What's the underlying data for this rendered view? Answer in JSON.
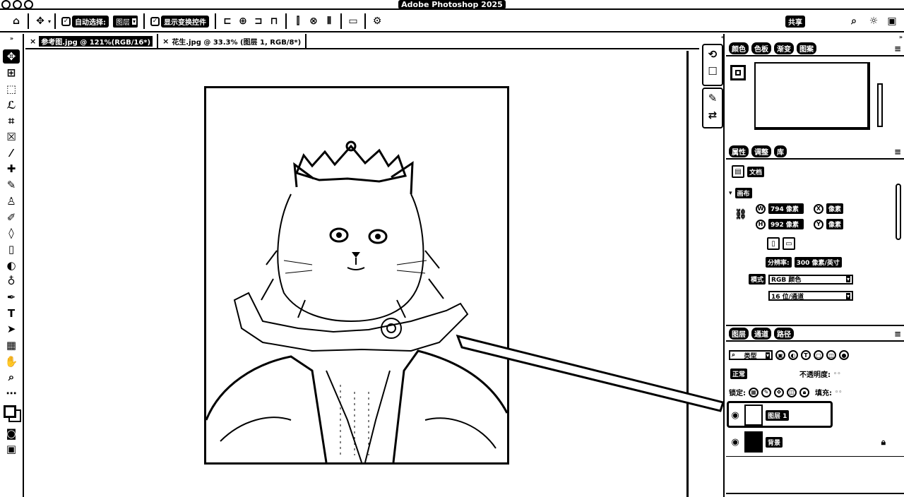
{
  "window": {
    "title": "Adobe Photoshop 2025"
  },
  "options_bar": {
    "home_icon": "home-icon",
    "move_icon": "move-tool-icon",
    "auto_select_label": "自动选择:",
    "auto_select_target": "图层",
    "show_transform_label": "显示变换控件",
    "share_label": "共享",
    "align_icons": [
      "align-left-icon",
      "align-hcenter-icon",
      "align-right-icon",
      "align-top-icon",
      "align-vcenter-icon",
      "align-bottom-icon",
      "distribute-icon"
    ],
    "right_icons": [
      "search-icon",
      "lightbulb-icon",
      "workspace-icon"
    ]
  },
  "tabs": [
    {
      "label": "参考图.jpg @ 121%(RGB/16*)",
      "active": true
    },
    {
      "label": "花生.jpg @ 33.3% (图层 1, RGB/8*)",
      "active": false
    }
  ],
  "tools": [
    "move-tool",
    "artboard-tool",
    "marquee-tool",
    "lasso-tool",
    "crop-tool",
    "frame-tool",
    "eyedropper-tool",
    "healing-brush-tool",
    "brush-tool",
    "clone-stamp-tool",
    "history-brush-tool",
    "eraser-tool",
    "gradient-tool",
    "blur-tool",
    "dodge-tool",
    "pen-tool",
    "type-tool",
    "path-selection-tool",
    "rectangle-tool",
    "hand-tool",
    "zoom-tool",
    "more-tools"
  ],
  "color_panel": {
    "tabs": [
      "颜色",
      "色板",
      "渐变",
      "图案"
    ]
  },
  "properties_panel": {
    "tabs": [
      "属性",
      "调整",
      "库"
    ],
    "document_label": "文档",
    "canvas_section": "画布",
    "width_label": "W",
    "width_value": "794 像素",
    "height_label": "H",
    "height_value": "992 像素",
    "x_label": "X",
    "x_value": "像素",
    "y_label": "Y",
    "y_value": "像素",
    "resolution_label": "分辨率:",
    "resolution_value": "300 像素/英寸",
    "mode_label": "模式",
    "mode_value": "RGB 颜色",
    "depth_value": "16 位/通道"
  },
  "layers_panel": {
    "tabs": [
      "图层",
      "通道",
      "路径"
    ],
    "filter_label": "类型",
    "blend_mode": "正常",
    "opacity_label": "不透明度:",
    "lock_label": "锁定:",
    "fill_label": "填充:",
    "layers": [
      {
        "name": "图层 1",
        "visible": true,
        "active": true,
        "locked": false
      },
      {
        "name": "背景",
        "visible": true,
        "active": false,
        "locked": true
      }
    ]
  }
}
